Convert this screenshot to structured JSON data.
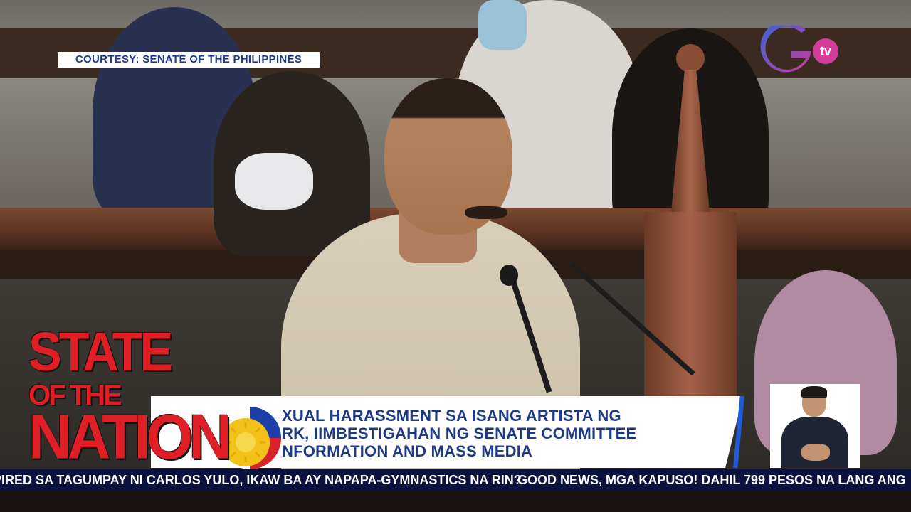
{
  "courtesy": {
    "text": "COURTESY: SENATE OF THE PHILIPPINES"
  },
  "logo": {
    "name": "gtv-logo",
    "tv_text": "tv",
    "colors": {
      "blue": "#2b6ad8",
      "magenta": "#d43c9a"
    }
  },
  "show_logo": {
    "line1": "STATE",
    "line2": "OF THE",
    "line3": "NATION",
    "color": "#e01e25"
  },
  "lower_third": {
    "headline_lines": [
      "KASO NG SEXUAL HARASSMENT SA ISANG ARTISTA NG",
      "ISANG NETWORK, IIMBESTIGAHAN NG SENATE COMMITTEE",
      "ON PUBLIC INFORMATION AND MASS MEDIA"
    ],
    "headline_visible": [
      "XUAL HARASSMENT SA ISANG ARTISTA NG",
      "RK, IIMBESTIGAHAN NG SENATE COMMITTEE",
      "NFORMATION AND MASS MEDIA"
    ],
    "accent_color": "#1f5bd8",
    "text_color": "#1d3a86"
  },
  "ticker": {
    "items": [
      "PIRED SA TAGUMPAY NI CARLOS YULO, IKAW BA AY NAPAPA-GYMNASTICS NA RIN?",
      "GOOD NEWS, MGA KAPUSO! DAHIL 799 PESOS NA LANG ANG"
    ],
    "visible_items": [
      "PIRED SA TAGUMPAY NI CARLOS YULO, IKAW BA AY NAPAPA-GYMNASTICS NA RIN?",
      "GOOD NEWS, MGA KAPUSO! DAHIL 799 PESOS NA LANG ANG"
    ],
    "background": "#0a1240"
  },
  "sign_language_inset": {
    "name": "sign-language-interpreter"
  }
}
